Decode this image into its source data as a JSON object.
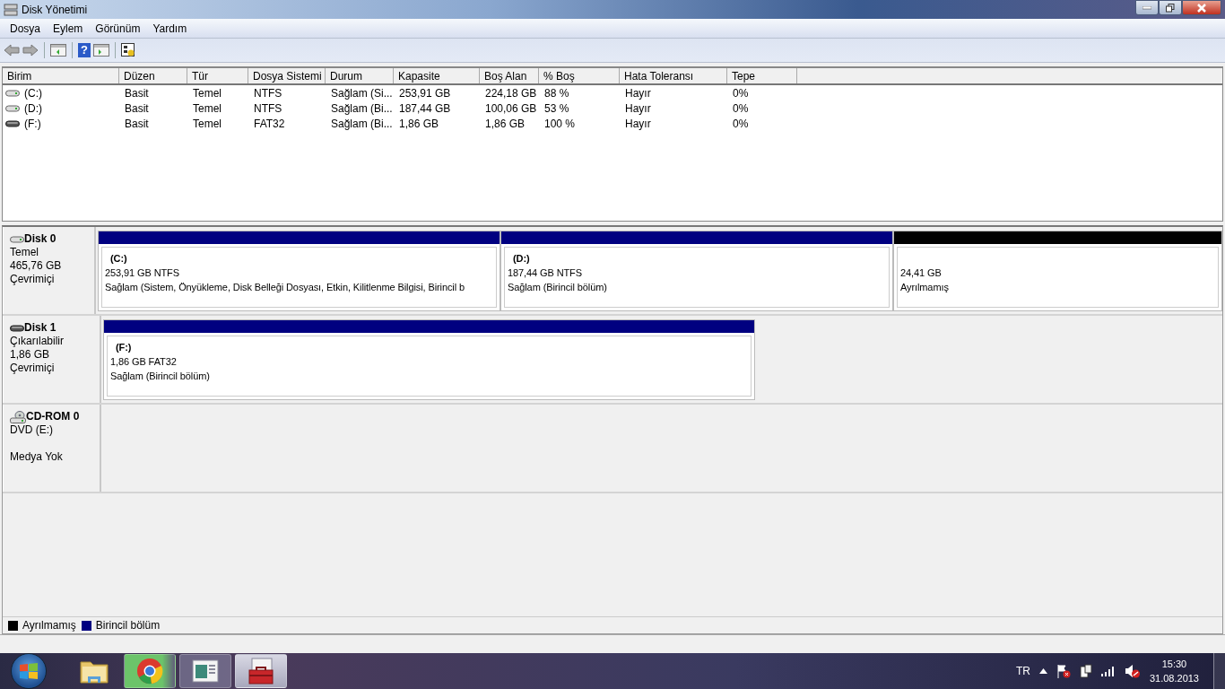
{
  "window": {
    "title": "Disk Yönetimi"
  },
  "menu": [
    "Dosya",
    "Eylem",
    "Görünüm",
    "Yardım"
  ],
  "toolbar": {
    "help_glyph": "?"
  },
  "table": {
    "columns": [
      "Birim",
      "Düzen",
      "Tür",
      "Dosya Sistemi",
      "Durum",
      "Kapasite",
      "Boş Alan",
      "% Boş",
      "Hata Toleransı",
      "Tepe"
    ],
    "rows": [
      {
        "kind": "fixed",
        "cells": [
          "(C:)",
          "Basit",
          "Temel",
          "NTFS",
          "Sağlam (Si...",
          "253,91 GB",
          "224,18 GB",
          "88 %",
          "Hayır",
          "0%"
        ]
      },
      {
        "kind": "fixed",
        "cells": [
          "(D:)",
          "Basit",
          "Temel",
          "NTFS",
          "Sağlam (Bi...",
          "187,44 GB",
          "100,06 GB",
          "53 %",
          "Hayır",
          "0%"
        ]
      },
      {
        "kind": "removable",
        "cells": [
          "(F:)",
          "Basit",
          "Temel",
          "FAT32",
          "Sağlam (Bi...",
          "1,86 GB",
          "1,86 GB",
          "100 %",
          "Hayır",
          "0%"
        ]
      }
    ]
  },
  "disks": [
    {
      "kind": "fixed",
      "name": "Disk 0",
      "lines": [
        "Temel",
        "465,76 GB",
        "Çevrimiçi"
      ],
      "partitions": [
        {
          "name": "(C:)",
          "size": "253,91 GB NTFS",
          "status": "Sağlam (Sistem, Önyükleme, Disk Belleği Dosyası, Etkin, Kilitlenme Bilgisi, Birincil b",
          "color": "#000080"
        },
        {
          "name": "(D:)",
          "size": "187,44 GB NTFS",
          "status": "Sağlam (Birincil bölüm)",
          "color": "#000080"
        },
        {
          "size": "24,41 GB",
          "status": "Ayrılmamış",
          "color": "#000000"
        }
      ]
    },
    {
      "kind": "removable",
      "name": "Disk 1",
      "lines": [
        "Çıkarılabilir",
        "1,86 GB",
        "Çevrimiçi"
      ],
      "partitions": [
        {
          "name": "(F:)",
          "size": "1,86 GB FAT32",
          "status": "Sağlam (Birincil bölüm)",
          "color": "#000080"
        }
      ]
    },
    {
      "kind": "cdrom",
      "name": "CD-ROM 0",
      "lines": [
        "DVD (E:)",
        "Medya Yok"
      ]
    }
  ],
  "legend": [
    {
      "label": "Ayrılmamış",
      "color": "#000000"
    },
    {
      "label": "Birincil bölüm",
      "color": "#000080"
    }
  ],
  "taskbar": {
    "apps": [
      {
        "kind": "explorer",
        "selected": false
      },
      {
        "kind": "browser",
        "selected": false
      },
      {
        "kind": "document",
        "selected": false
      },
      {
        "kind": "toolbox",
        "selected": true
      }
    ],
    "language": "TR",
    "time": "15:30",
    "date": "31.08.2013"
  }
}
